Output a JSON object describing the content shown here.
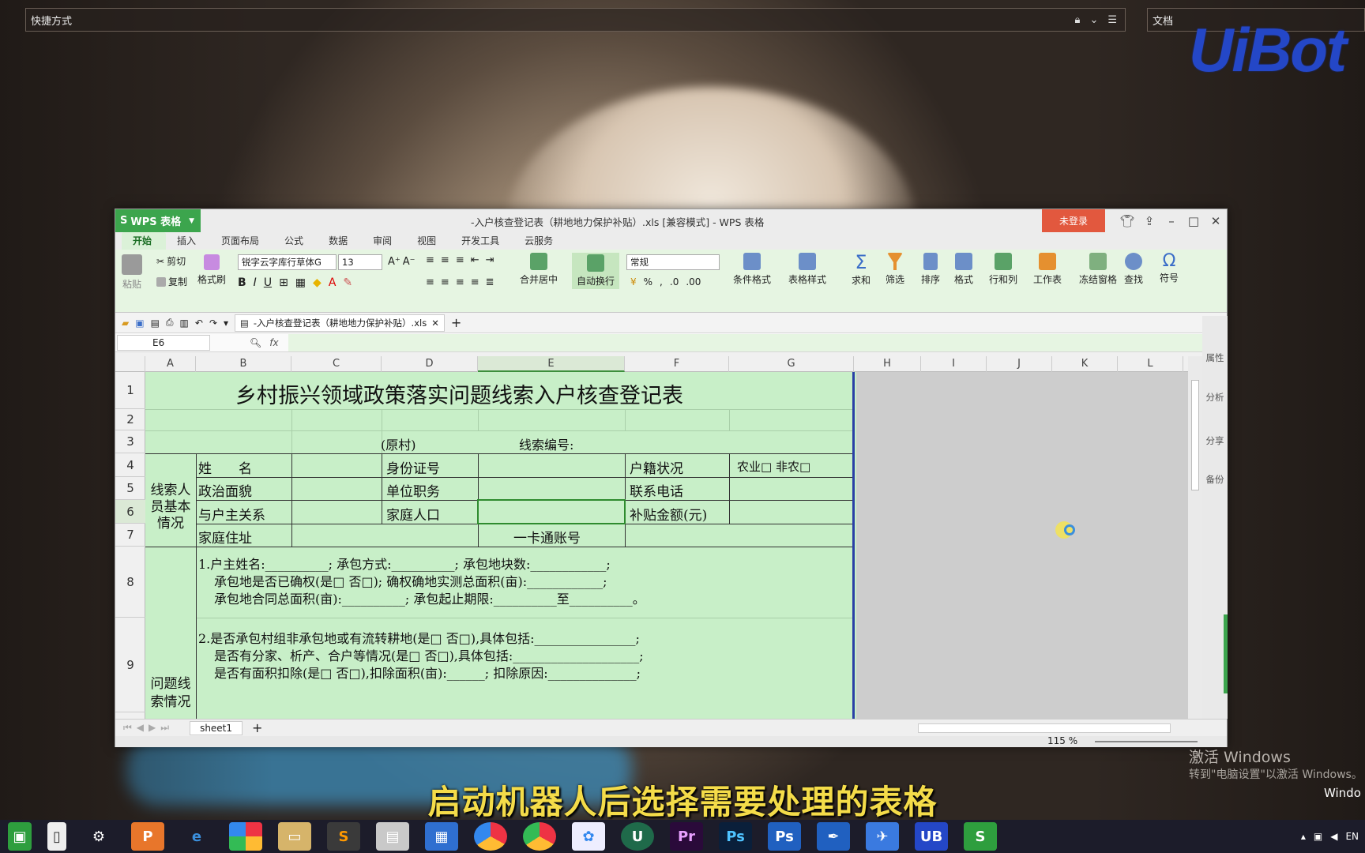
{
  "desktop": {
    "shortcut_bar": "快捷方式",
    "doc_bar": "文档",
    "logo": "UiBot"
  },
  "window": {
    "app_button": "WPS 表格",
    "title": "-入户核查登记表（耕地地力保护补贴）.xls [兼容模式] - WPS 表格",
    "login": "未登录",
    "tabs": [
      "开始",
      "插入",
      "页面布局",
      "公式",
      "数据",
      "审阅",
      "视图",
      "开发工具",
      "云服务"
    ],
    "ribbon": {
      "paste": "粘贴",
      "cut": "剪切",
      "copy": "复制",
      "format_painter": "格式刷",
      "font": "锐字云字库行草体G",
      "size": "13",
      "number_format": "常规",
      "merge": "合并居中",
      "wrap": "自动换行",
      "cond_format": "条件格式",
      "table_style": "表格样式",
      "sum": "求和",
      "filter": "筛选",
      "sort": "排序",
      "format": "格式",
      "rowcol": "行和列",
      "sheet": "工作表",
      "freeze": "冻结窗格",
      "find": "查找",
      "symbol": "符号"
    },
    "doc_tab": "-入户核查登记表（耕地地力保护补贴）.xls",
    "name_box": "E6",
    "fx": "fx",
    "columns": [
      "A",
      "B",
      "C",
      "D",
      "E",
      "F",
      "G",
      "H",
      "I",
      "J",
      "K",
      "L"
    ],
    "rows": [
      "1",
      "2",
      "3",
      "4",
      "5",
      "6",
      "7",
      "8",
      "9"
    ],
    "side_panel": [
      "属性",
      "分析",
      "分享",
      "备份"
    ],
    "sheet_tab": "sheet1",
    "zoom": "115 %"
  },
  "form": {
    "title": "乡村振兴领域政策落实问题线索入户核查登记表",
    "origin": "(原村)",
    "clue_no": "线索编号:",
    "section1": "线索人员基本情况",
    "name": "姓　　名",
    "id": "身份证号",
    "household": "户籍状况",
    "household_opts": "农业□ 非农□",
    "politics": "政治面貌",
    "job": "单位职务",
    "phone": "联系电话",
    "relation": "与户主关系",
    "family": "家庭人口",
    "subsidy": "补贴金额(元)",
    "address": "家庭住址",
    "card": "一卡通账号",
    "section2": "问题线索情况",
    "p1a": "1.户主姓名:__________; 承包方式:__________; 承包地块数:____________;",
    "p1b": "承包地是否已确权(是□ 否□); 确权确地实测总面积(亩):____________;",
    "p1c": "承包地合同总面积(亩):__________; 承包起止期限:__________至__________。",
    "p2a": "2.是否承包村组非承包地或有流转耕地(是□ 否□),具体包括:________________;",
    "p2b": "是否有分家、析产、合户等情况(是□ 否□),具体包括:____________________;",
    "p2c": "是否有面积扣除(是□ 否□),扣除面积(亩):______; 扣除原因:______________;"
  },
  "overlay": {
    "activate1": "激活 Windows",
    "activate2": "转到\"电脑设置\"以激活 Windows。",
    "activate3": "Windo",
    "subtitle": "启动机器人后选择需要处理的表格",
    "tray": "EN"
  }
}
